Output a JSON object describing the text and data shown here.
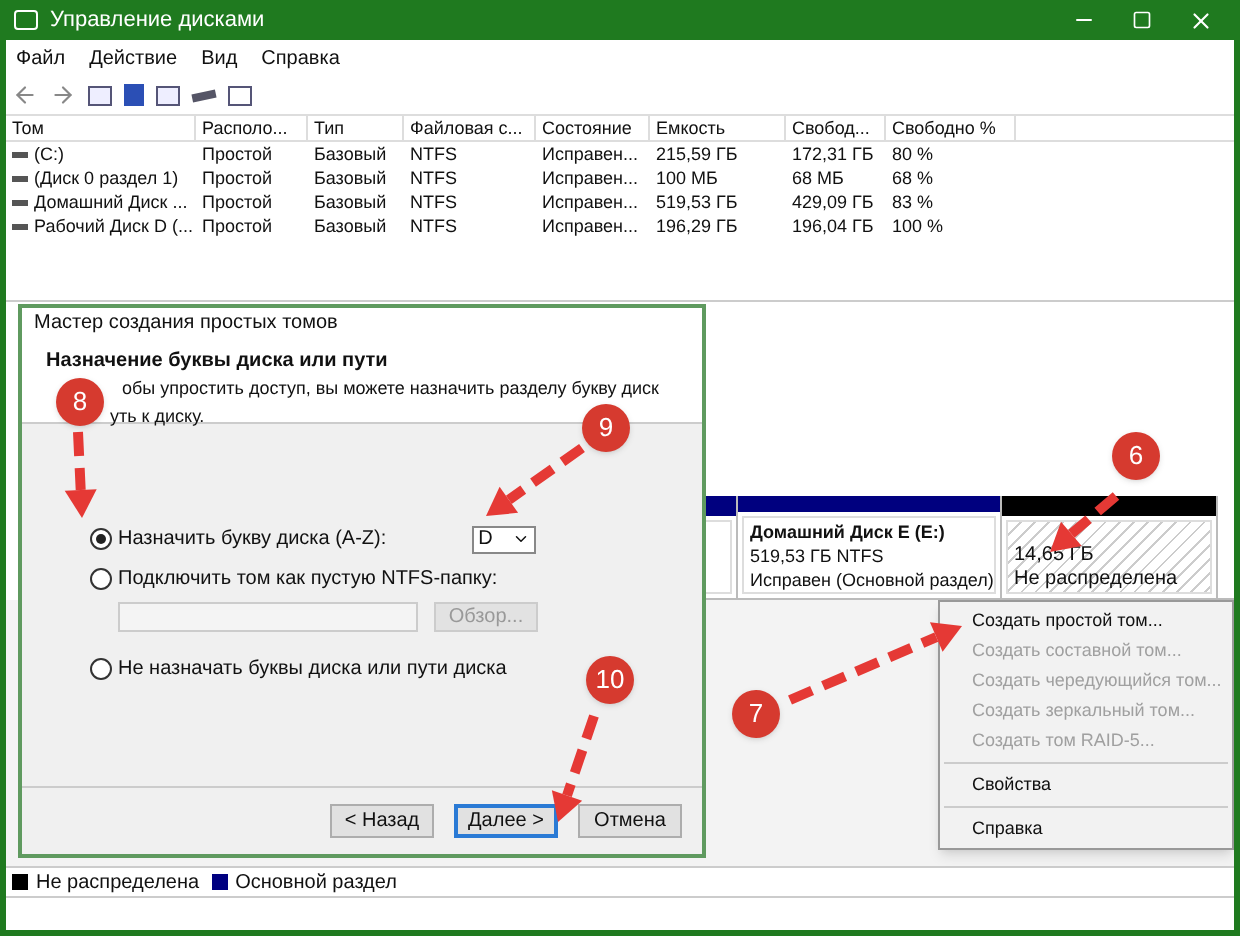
{
  "window": {
    "title": "Управление дисками"
  },
  "menu": [
    "Файл",
    "Действие",
    "Вид",
    "Справка"
  ],
  "volumes": {
    "columns": [
      "Том",
      "Располо...",
      "Тип",
      "Файловая с...",
      "Состояние",
      "Емкость",
      "Свобод...",
      "Свободно %"
    ],
    "rows": [
      [
        "(C:)",
        "Простой",
        "Базовый",
        "NTFS",
        "Исправен...",
        "215,59 ГБ",
        "172,31 ГБ",
        "80 %"
      ],
      [
        "(Диск 0 раздел 1)",
        "Простой",
        "Базовый",
        "NTFS",
        "Исправен...",
        "100 МБ",
        "68 МБ",
        "68 %"
      ],
      [
        "Домашний Диск ...",
        "Простой",
        "Базовый",
        "NTFS",
        "Исправен...",
        "519,53 ГБ",
        "429,09 ГБ",
        "83 %"
      ],
      [
        "Рабочий Диск D (...",
        "Простой",
        "Базовый",
        "NTFS",
        "Исправен...",
        "196,29 ГБ",
        "196,04 ГБ",
        "100 %"
      ]
    ]
  },
  "disk_map": {
    "partitions": [
      {
        "kind": "primary"
      },
      {
        "kind": "primary",
        "name": "Домашний Диск E (E:)",
        "size": "519,53 ГБ NTFS",
        "status": "Исправен (Основной раздел)"
      },
      {
        "kind": "unallocated",
        "size": "14,65 ГБ",
        "status": "Не распределена"
      }
    ]
  },
  "context_menu": [
    {
      "kind": "item",
      "label": "Создать простой том...",
      "disabled": false
    },
    {
      "kind": "item",
      "label": "Создать составной том...",
      "disabled": true
    },
    {
      "kind": "item",
      "label": "Создать чередующийся том...",
      "disabled": true
    },
    {
      "kind": "item",
      "label": "Создать зеркальный том...",
      "disabled": true
    },
    {
      "kind": "item",
      "label": "Создать том RAID-5...",
      "disabled": true
    },
    {
      "kind": "separator"
    },
    {
      "kind": "item",
      "label": "Свойства",
      "disabled": false
    },
    {
      "kind": "separator"
    },
    {
      "kind": "item",
      "label": "Справка",
      "disabled": false
    }
  ],
  "legend": [
    {
      "label": "Не распределена",
      "color": "#000000"
    },
    {
      "label": "Основной раздел",
      "color": "#000080"
    }
  ],
  "wizard": {
    "title": "Мастер создания простых томов",
    "heading": "Назначение буквы диска или пути",
    "description": [
      "обы упростить доступ, вы можете назначить разделу букву диск",
      "уть к диску."
    ],
    "options": [
      {
        "kind": "letter",
        "label": "Назначить букву диска (A-Z):",
        "selected": true,
        "value": "D"
      },
      {
        "kind": "folder",
        "label": "Подключить том как пустую NTFS-папку:",
        "selected": false,
        "browse": "Обзор..."
      },
      {
        "kind": "none",
        "label": "Не назначать буквы диска или пути диска",
        "selected": false
      }
    ],
    "buttons": [
      {
        "label": "< Назад",
        "default": false
      },
      {
        "label": "Далее >",
        "default": true
      },
      {
        "label": "Отмена",
        "default": false
      }
    ]
  },
  "annotations": [
    "6",
    "7",
    "8",
    "9",
    "10"
  ]
}
